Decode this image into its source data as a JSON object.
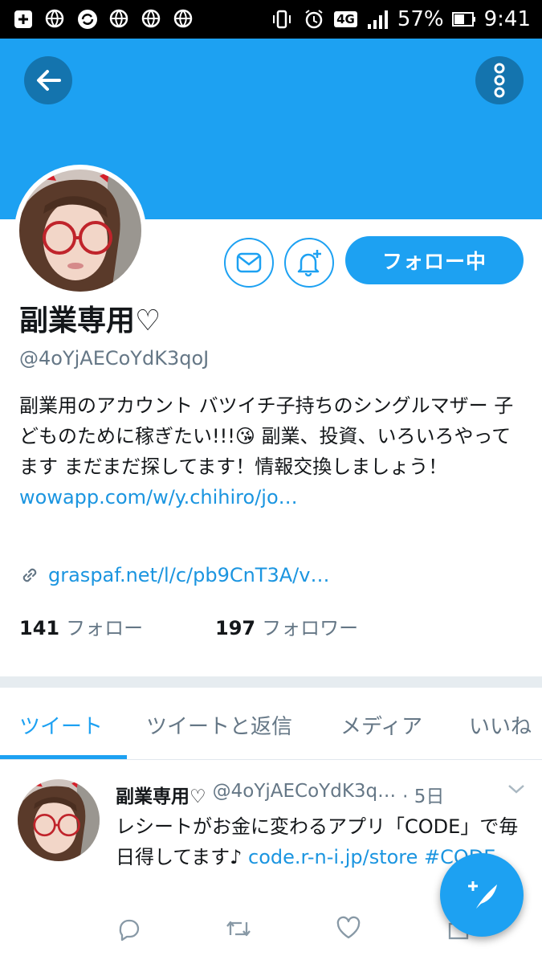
{
  "status_bar": {
    "battery": "57%",
    "time": "9:41",
    "network": "4G"
  },
  "profile": {
    "display_name": "副業専用♡",
    "handle": "@4oYjAECoYdK3qoJ",
    "follow_button": "フォロー中",
    "bio_text": "副業用のアカウント バツイチ子持ちのシングルマザー 子どものために稼ぎたい!!!😘 副業、投資、いろいろやってます まだまだ探してます！情報交換しましょう！ ",
    "bio_link": "wowapp.com/w/y.chihiro/jo…",
    "url": "graspaf.net/l/c/pb9CnT3A/v…",
    "following_count": "141",
    "following_label": "フォロー",
    "followers_count": "197",
    "followers_label": "フォロワー"
  },
  "tabs": [
    {
      "label": "ツイート",
      "active": true
    },
    {
      "label": "ツイートと返信",
      "active": false
    },
    {
      "label": "メディア",
      "active": false
    },
    {
      "label": "いいね",
      "active": false
    }
  ],
  "tweet": {
    "name": "副業専用♡",
    "handle": "@4oYjAECoYdK3q…",
    "time": "· 5日",
    "text": "レシートがお金に変わるアプリ「CODE」で毎日得してます♪ ",
    "link": "code.r-n-i.jp/store",
    "hashtag": " #CODE"
  },
  "colors": {
    "accent": "#1da1f2",
    "link": "#1b95e0",
    "muted": "#657786"
  }
}
